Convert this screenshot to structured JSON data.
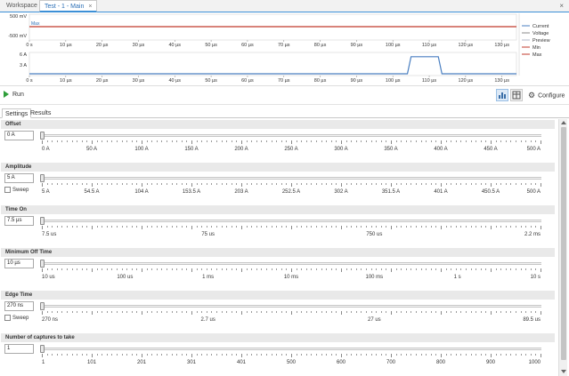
{
  "tabs": [
    {
      "label": "Workspace"
    },
    {
      "label": "Test - 1 - Main",
      "close": "×"
    }
  ],
  "window_close": "×",
  "chart_data": [
    {
      "type": "line",
      "title": "",
      "x": [
        0,
        10,
        20,
        30,
        40,
        50,
        60,
        70,
        80,
        90,
        100,
        110,
        120,
        130
      ],
      "x_tick_labels": [
        "0 s",
        "10 µs",
        "20 µs",
        "30 µs",
        "40 µs",
        "50 µs",
        "60 µs",
        "70 µs",
        "80 µs",
        "90 µs",
        "100 µs",
        "110 µs",
        "120 µs",
        "130 µs"
      ],
      "xlim": [
        0,
        134
      ],
      "y_tick_labels": [
        "500 mV",
        "-500 mV"
      ],
      "ylim": [
        -500,
        500
      ],
      "series_label": "Max",
      "series": [
        {
          "name": "Max",
          "color": "#c0392b",
          "values": [
            [
              0,
              0
            ],
            [
              134,
              0
            ]
          ]
        }
      ]
    },
    {
      "type": "line",
      "title": "",
      "x": [
        0,
        10,
        20,
        30,
        40,
        50,
        60,
        70,
        80,
        90,
        100,
        110,
        120,
        130
      ],
      "x_tick_labels": [
        "0 s",
        "10 µs",
        "20 µs",
        "30 µs",
        "40 µs",
        "50 µs",
        "60 µs",
        "70 µs",
        "80 µs",
        "90 µs",
        "100 µs",
        "110 µs",
        "120 µs",
        "130 µs"
      ],
      "xlim": [
        0,
        134
      ],
      "y_tick_labels": [
        "6 A",
        "3 A"
      ],
      "ylim": [
        0,
        6
      ],
      "series": [
        {
          "name": "Current",
          "color": "#4a7fc1",
          "values": [
            [
              0,
              0
            ],
            [
              104,
              0
            ],
            [
              105,
              5
            ],
            [
              112.5,
              5
            ],
            [
              113.5,
              0
            ],
            [
              134,
              0
            ]
          ]
        }
      ]
    }
  ],
  "legend": [
    {
      "label": "Current",
      "color": "#4a7fc1"
    },
    {
      "label": "Voltage",
      "color": "#8a8a8a"
    },
    {
      "label": "Preview",
      "color": "#b0b8c8"
    },
    {
      "label": "Min",
      "color": "#c0392b"
    },
    {
      "label": "Max",
      "color": "#c0392b"
    }
  ],
  "toolbar": {
    "run_label": "Run",
    "configure_label": "Configure"
  },
  "settings_tabs": [
    {
      "label": "Settings"
    },
    {
      "label": "Results"
    }
  ],
  "sections": [
    {
      "title": "Offset",
      "value": "0 A",
      "sweep": "",
      "thumb": 0.0,
      "labels": [
        "0 A",
        "50 A",
        "100 A",
        "150 A",
        "200 A",
        "250 A",
        "300 A",
        "350 A",
        "400 A",
        "450 A",
        "500 A"
      ]
    },
    {
      "title": "Amplitude",
      "value": "5 A",
      "sweep": "Sweep",
      "thumb": 0.0,
      "labels": [
        "5 A",
        "54.5 A",
        "104 A",
        "153.5 A",
        "203 A",
        "252.5 A",
        "302 A",
        "351.5 A",
        "401 A",
        "450.5 A",
        "500 A"
      ]
    },
    {
      "title": "Time On",
      "value": "7.5 µs",
      "sweep": "",
      "thumb": 0.0,
      "labels": [
        "7.5 us",
        "75 us",
        "750 us",
        "2.2 ms"
      ]
    },
    {
      "title": "Minimum Off Time",
      "value": "10 µs",
      "sweep": "",
      "thumb": 0.0,
      "labels": [
        "10 us",
        "100 us",
        "1 ms",
        "10 ms",
        "100 ms",
        "1 s",
        "10 s"
      ]
    },
    {
      "title": "Edge Time",
      "value": "270 ns",
      "sweep": "Sweep",
      "thumb": 0.0,
      "labels": [
        "270 ns",
        "2.7 us",
        "27 us",
        "89.5 us"
      ]
    },
    {
      "title": "Number of captures to take",
      "value": "1",
      "sweep": "",
      "thumb": 0.0,
      "labels": [
        "1",
        "101",
        "201",
        "301",
        "401",
        "500",
        "600",
        "700",
        "800",
        "900",
        "1000"
      ]
    }
  ]
}
